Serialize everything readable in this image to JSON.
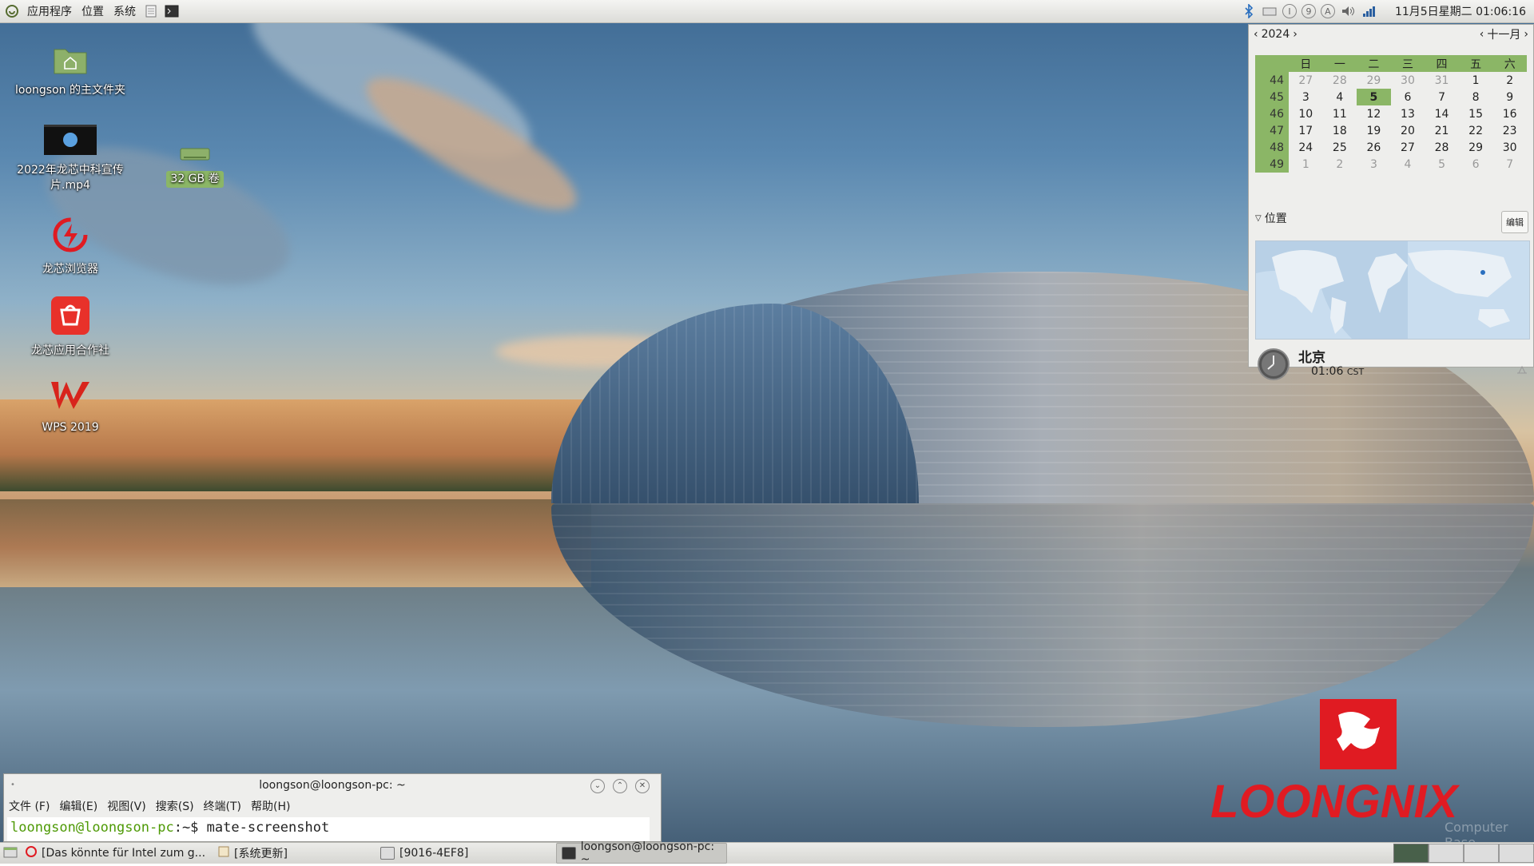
{
  "top_panel": {
    "menus": [
      "应用程序",
      "位置",
      "系统"
    ],
    "clock": "11月5日星期二 01:06:16",
    "tray_circles": [
      "I",
      "9",
      "A"
    ]
  },
  "desktop_icons": [
    {
      "label": "loongson 的主文件夹",
      "icon": "home-folder-icon"
    },
    {
      "label": "2022年龙芯中科宣传片.mp4",
      "icon": "video-file-icon"
    },
    {
      "label": "32 GB 卷",
      "icon": "drive-icon"
    },
    {
      "label": "龙芯浏览器",
      "icon": "browser-icon"
    },
    {
      "label": "龙芯应用合作社",
      "icon": "app-store-icon"
    },
    {
      "label": "WPS 2019",
      "icon": "wps-icon"
    }
  ],
  "calendar": {
    "year": "2024",
    "month": "十一月",
    "weekday_headers": [
      "日",
      "一",
      "二",
      "三",
      "四",
      "五",
      "六"
    ],
    "weeks": [
      {
        "wk": "44",
        "days": [
          "27",
          "28",
          "29",
          "30",
          "31",
          "1",
          "2"
        ],
        "dim": [
          0,
          1,
          2,
          3,
          4
        ]
      },
      {
        "wk": "45",
        "days": [
          "3",
          "4",
          "5",
          "6",
          "7",
          "8",
          "9"
        ],
        "today": 2
      },
      {
        "wk": "46",
        "days": [
          "10",
          "11",
          "12",
          "13",
          "14",
          "15",
          "16"
        ]
      },
      {
        "wk": "47",
        "days": [
          "17",
          "18",
          "19",
          "20",
          "21",
          "22",
          "23"
        ]
      },
      {
        "wk": "48",
        "days": [
          "24",
          "25",
          "26",
          "27",
          "28",
          "29",
          "30"
        ]
      },
      {
        "wk": "49",
        "days": [
          "1",
          "2",
          "3",
          "4",
          "5",
          "6",
          "7"
        ],
        "dim": [
          0,
          1,
          2,
          3,
          4,
          5,
          6
        ]
      }
    ],
    "locations_label": "位置",
    "edit_label": "编辑",
    "location": {
      "city": "北京",
      "time": "01:06",
      "tz": "CST"
    }
  },
  "terminal": {
    "title": "loongson@loongson-pc: ~",
    "menus": [
      "文件 (F)",
      "编辑(E)",
      "视图(V)",
      "搜索(S)",
      "终端(T)",
      "帮助(H)"
    ],
    "prompt_user": "loongson@loongson-pc",
    "prompt_path": ":~$ ",
    "command": "mate-screenshot"
  },
  "taskbar": {
    "tasks": [
      {
        "label": "[Das könnte für Intel zum g..."
      },
      {
        "label": "[系统更新]"
      },
      {
        "label": "[9016-4EF8]"
      },
      {
        "label": "loongson@loongson-pc: ~"
      }
    ]
  },
  "branding": {
    "logo_text": "LOONGNIX",
    "watermark": "Computer Base"
  },
  "colors": {
    "calendar_accent": "#8bb666",
    "logo_red": "#e01b22",
    "prompt_green": "#4e9a06"
  }
}
